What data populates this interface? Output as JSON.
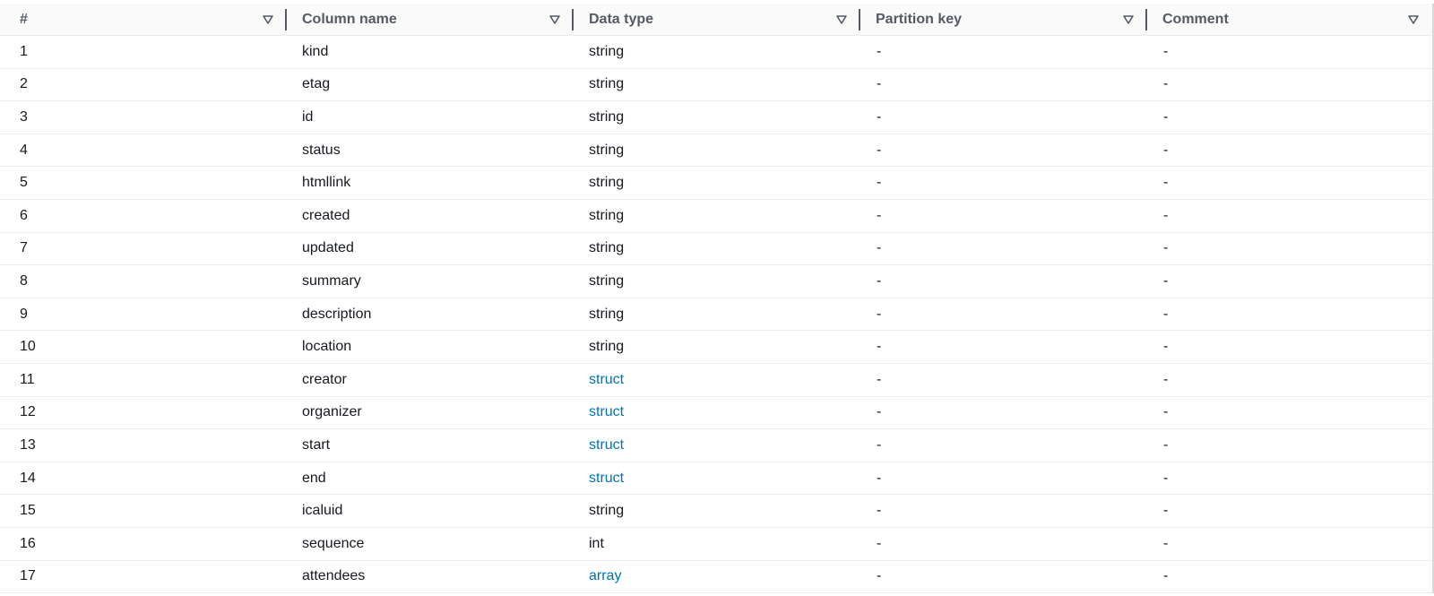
{
  "table": {
    "columns": [
      {
        "label": "#"
      },
      {
        "label": "Column name"
      },
      {
        "label": "Data type"
      },
      {
        "label": "Partition key"
      },
      {
        "label": "Comment"
      }
    ],
    "rows": [
      {
        "num": "1",
        "name": "kind",
        "type": "string",
        "type_link": false,
        "partition": "-",
        "comment": "-"
      },
      {
        "num": "2",
        "name": "etag",
        "type": "string",
        "type_link": false,
        "partition": "-",
        "comment": "-"
      },
      {
        "num": "3",
        "name": "id",
        "type": "string",
        "type_link": false,
        "partition": "-",
        "comment": "-"
      },
      {
        "num": "4",
        "name": "status",
        "type": "string",
        "type_link": false,
        "partition": "-",
        "comment": "-"
      },
      {
        "num": "5",
        "name": "htmllink",
        "type": "string",
        "type_link": false,
        "partition": "-",
        "comment": "-"
      },
      {
        "num": "6",
        "name": "created",
        "type": "string",
        "type_link": false,
        "partition": "-",
        "comment": "-"
      },
      {
        "num": "7",
        "name": "updated",
        "type": "string",
        "type_link": false,
        "partition": "-",
        "comment": "-"
      },
      {
        "num": "8",
        "name": "summary",
        "type": "string",
        "type_link": false,
        "partition": "-",
        "comment": "-"
      },
      {
        "num": "9",
        "name": "description",
        "type": "string",
        "type_link": false,
        "partition": "-",
        "comment": "-"
      },
      {
        "num": "10",
        "name": "location",
        "type": "string",
        "type_link": false,
        "partition": "-",
        "comment": "-"
      },
      {
        "num": "11",
        "name": "creator",
        "type": "struct",
        "type_link": true,
        "partition": "-",
        "comment": "-"
      },
      {
        "num": "12",
        "name": "organizer",
        "type": "struct",
        "type_link": true,
        "partition": "-",
        "comment": "-"
      },
      {
        "num": "13",
        "name": "start",
        "type": "struct",
        "type_link": true,
        "partition": "-",
        "comment": "-"
      },
      {
        "num": "14",
        "name": "end",
        "type": "struct",
        "type_link": true,
        "partition": "-",
        "comment": "-"
      },
      {
        "num": "15",
        "name": "icaluid",
        "type": "string",
        "type_link": false,
        "partition": "-",
        "comment": "-"
      },
      {
        "num": "16",
        "name": "sequence",
        "type": "int",
        "type_link": false,
        "partition": "-",
        "comment": "-"
      },
      {
        "num": "17",
        "name": "attendees",
        "type": "array",
        "type_link": true,
        "partition": "-",
        "comment": "-"
      }
    ]
  },
  "icons": {
    "sort": "filter-caret-down-icon"
  },
  "colors": {
    "link": "#0073bb",
    "header_text": "#545b64",
    "body_text": "#16191f",
    "row_border": "#eaeded"
  }
}
